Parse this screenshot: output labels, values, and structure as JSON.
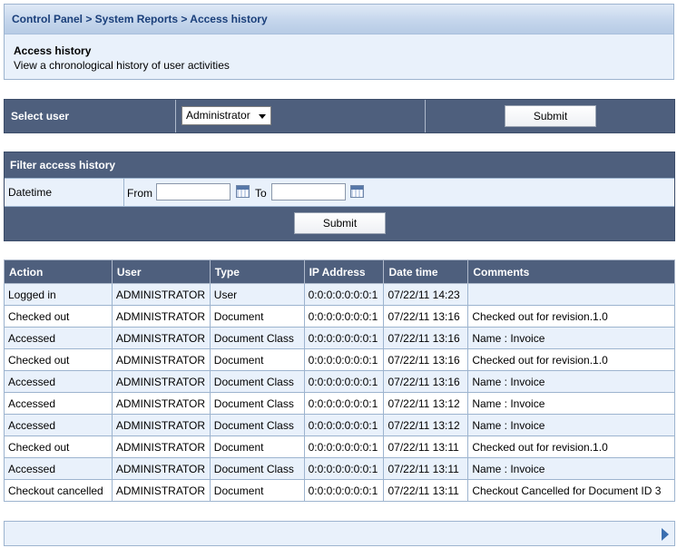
{
  "breadcrumb": "Control Panel > System Reports > Access history",
  "page": {
    "title": "Access history",
    "description": "View a chronological history of user activities"
  },
  "select_user": {
    "label": "Select user",
    "selected": "Administrator",
    "submit": "Submit"
  },
  "filter": {
    "title": "Filter access history",
    "datetime_label": "Datetime",
    "from_label": "From",
    "to_label": "To",
    "from_value": "",
    "to_value": "",
    "submit": "Submit"
  },
  "table": {
    "headers": [
      "Action",
      "User",
      "Type",
      "IP Address",
      "Date time",
      "Comments"
    ],
    "rows": [
      [
        "Logged in",
        "ADMINISTRATOR",
        "User",
        "0:0:0:0:0:0:0:1",
        "07/22/11 14:23",
        ""
      ],
      [
        "Checked out",
        "ADMINISTRATOR",
        "Document",
        "0:0:0:0:0:0:0:1",
        "07/22/11 13:16",
        "Checked out for revision.1.0"
      ],
      [
        "Accessed",
        "ADMINISTRATOR",
        "Document Class",
        "0:0:0:0:0:0:0:1",
        "07/22/11 13:16",
        "Name : Invoice"
      ],
      [
        "Checked out",
        "ADMINISTRATOR",
        "Document",
        "0:0:0:0:0:0:0:1",
        "07/22/11 13:16",
        "Checked out for revision.1.0"
      ],
      [
        "Accessed",
        "ADMINISTRATOR",
        "Document Class",
        "0:0:0:0:0:0:0:1",
        "07/22/11 13:16",
        "Name : Invoice"
      ],
      [
        "Accessed",
        "ADMINISTRATOR",
        "Document Class",
        "0:0:0:0:0:0:0:1",
        "07/22/11 13:12",
        "Name : Invoice"
      ],
      [
        "Accessed",
        "ADMINISTRATOR",
        "Document Class",
        "0:0:0:0:0:0:0:1",
        "07/22/11 13:12",
        "Name : Invoice"
      ],
      [
        "Checked out",
        "ADMINISTRATOR",
        "Document",
        "0:0:0:0:0:0:0:1",
        "07/22/11 13:11",
        "Checked out for revision.1.0"
      ],
      [
        "Accessed",
        "ADMINISTRATOR",
        "Document Class",
        "0:0:0:0:0:0:0:1",
        "07/22/11 13:11",
        "Name : Invoice"
      ],
      [
        "Checkout cancelled",
        "ADMINISTRATOR",
        "Document",
        "0:0:0:0:0:0:0:1",
        "07/22/11 13:11",
        "Checkout Cancelled for Document ID 3"
      ]
    ]
  },
  "icons": {
    "calendar": "calendar-icon",
    "next": "next-page-icon"
  },
  "colors": {
    "header_dark": "#4e5f7d",
    "row_light": "#e9f1fb",
    "breadcrumb_text": "#1a3f7a"
  }
}
